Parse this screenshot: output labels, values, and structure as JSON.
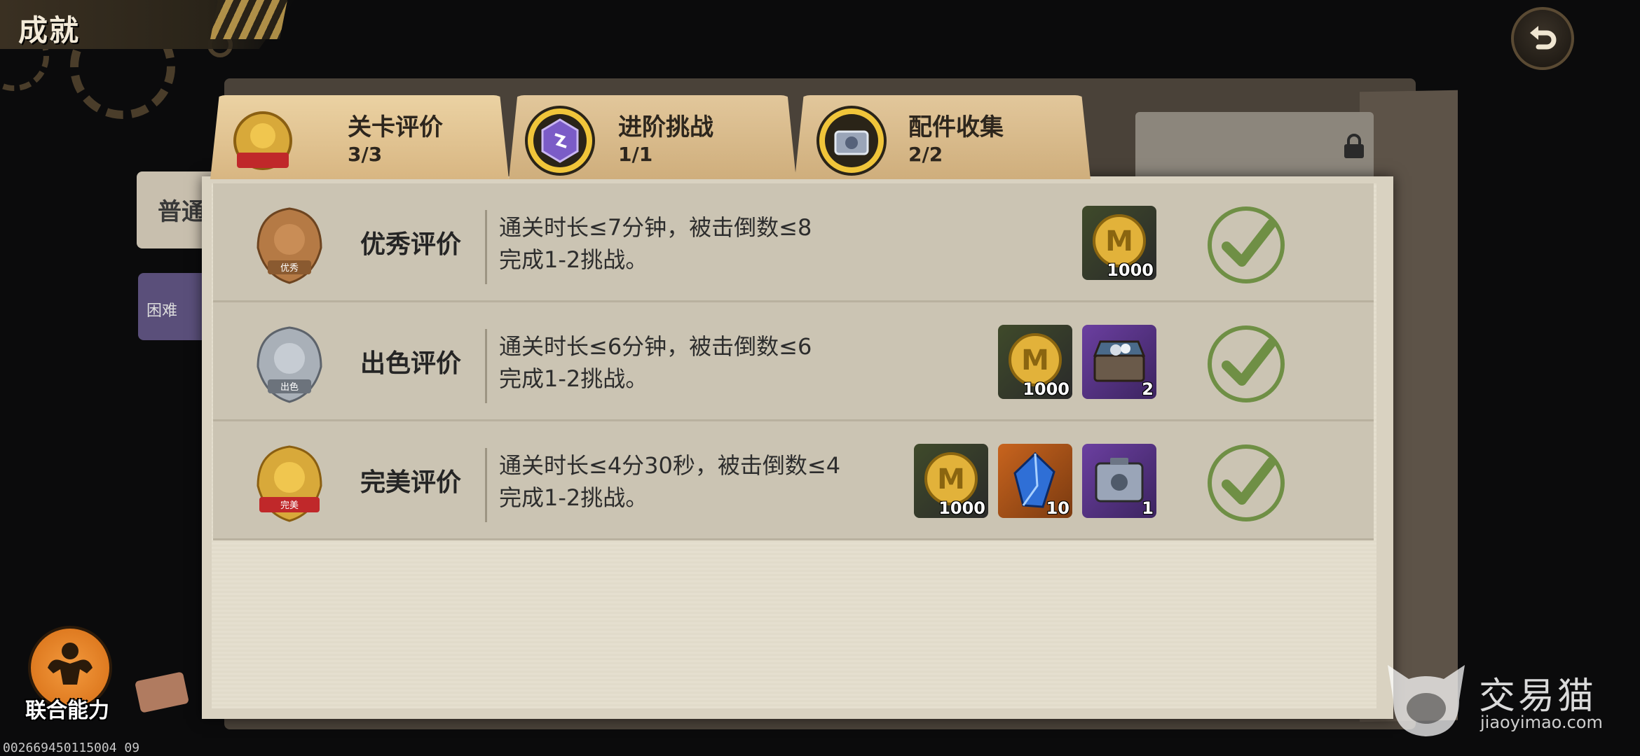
{
  "header": {
    "title": "成就"
  },
  "tabs": [
    {
      "label": "关卡评价",
      "count": "3/3",
      "icon": "gold-medal-icon",
      "active": true
    },
    {
      "label": "进阶挑战",
      "count": "1/1",
      "icon": "advanced-challenge-icon",
      "active": false
    },
    {
      "label": "配件收集",
      "count": "2/2",
      "icon": "parts-collection-icon",
      "active": false
    }
  ],
  "side_tabs": {
    "normal": "普通",
    "hard": "困难"
  },
  "rows": [
    {
      "name": "优秀评价",
      "medal_label": "优秀",
      "medal": "bronze",
      "line1": "通关时长≤7分钟，被击倒数≤8",
      "line2": "完成1-2挑战。",
      "rewards": [
        {
          "icon": "gold-coin-icon",
          "qty": "1000"
        }
      ],
      "completed": true
    },
    {
      "name": "出色评价",
      "medal_label": "出色",
      "medal": "silver",
      "line1": "通关时长≤6分钟，被击倒数≤6",
      "line2": "完成1-2挑战。",
      "rewards": [
        {
          "icon": "gold-coin-icon",
          "qty": "1000"
        },
        {
          "icon": "treasure-chest-icon",
          "qty": "2"
        }
      ],
      "completed": true
    },
    {
      "name": "完美评价",
      "medal_label": "完美",
      "medal": "gold",
      "line1": "通关时长≤4分30秒，被击倒数≤4",
      "line2": "完成1-2挑战。",
      "rewards": [
        {
          "icon": "gold-coin-icon",
          "qty": "1000"
        },
        {
          "icon": "blue-crystal-icon",
          "qty": "10"
        },
        {
          "icon": "parts-case-icon",
          "qty": "1"
        }
      ],
      "completed": true
    }
  ],
  "bottom": {
    "union_label": "联合能力",
    "uid": "002669450115004 09"
  },
  "watermark": {
    "cn": "交易猫",
    "en": "jiaoyimao.com"
  },
  "colors": {
    "gold": "#d8a93a",
    "check_green": "#6f8f45",
    "tab_bg": "#d8b682",
    "paper": "#e3ddcd"
  }
}
